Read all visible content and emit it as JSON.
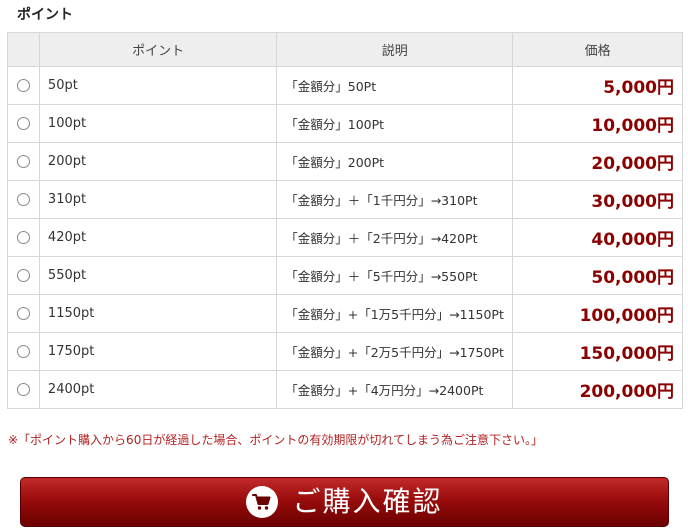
{
  "section_title": "ポイント",
  "table": {
    "headers": {
      "point": "ポイント",
      "description": "説明",
      "price": "価格"
    },
    "rows": [
      {
        "point": "50pt",
        "description": "「金額分」50Pt",
        "price": "5,000円"
      },
      {
        "point": "100pt",
        "description": "「金額分」100Pt",
        "price": "10,000円"
      },
      {
        "point": "200pt",
        "description": "「金額分」200Pt",
        "price": "20,000円"
      },
      {
        "point": "310pt",
        "description": "「金額分」＋「1千円分」→310Pt",
        "price": "30,000円"
      },
      {
        "point": "420pt",
        "description": "「金額分」＋「2千円分」→420Pt",
        "price": "40,000円"
      },
      {
        "point": "550pt",
        "description": "「金額分」＋「5千円分」→550Pt",
        "price": "50,000円"
      },
      {
        "point": "1150pt",
        "description": "「金額分」+「1万5千円分」→1150Pt",
        "price": "100,000円"
      },
      {
        "point": "1750pt",
        "description": "「金額分」+「2万5千円分」→1750Pt",
        "price": "150,000円"
      },
      {
        "point": "2400pt",
        "description": "「金額分」+「4万円分」→2400Pt",
        "price": "200,000円"
      }
    ]
  },
  "notice": "※「ポイント購入から60日が経過した場合、ポイントの有効期限が切れてしまう為ご注意下さい。」",
  "purchase_button": {
    "label": "ご購入確認",
    "icon": "cart-icon"
  },
  "colors": {
    "price": "#8b0000",
    "notice": "#b22222",
    "button": "#9a0c0c"
  }
}
